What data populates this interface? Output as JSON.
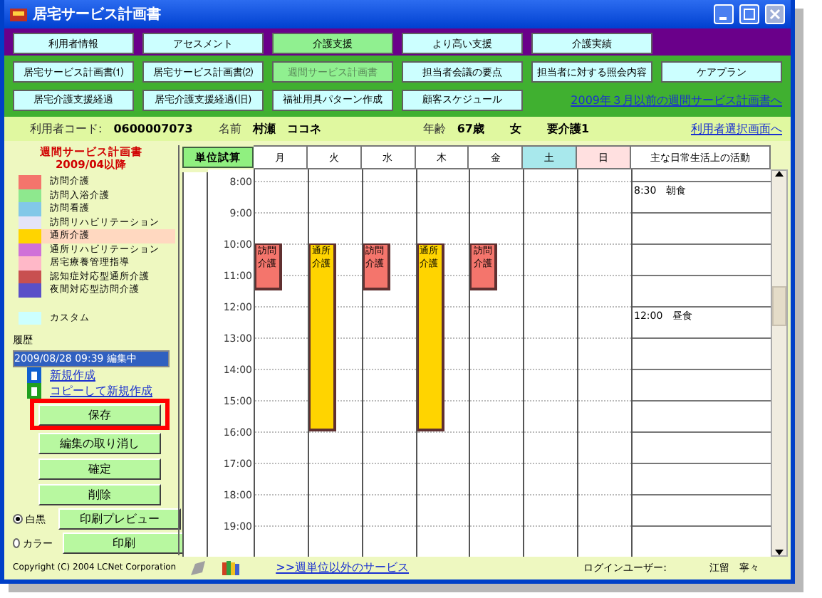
{
  "window": {
    "title": "居宅サービス計画書"
  },
  "nav_primary": [
    {
      "label": "利用者情報",
      "selected": false
    },
    {
      "label": "アセスメント",
      "selected": false
    },
    {
      "label": "介護支援",
      "selected": true
    },
    {
      "label": "より高い支援",
      "selected": false
    },
    {
      "label": "介護実績",
      "selected": false
    }
  ],
  "nav_secondary": [
    {
      "label": "居宅サービス計画書⑴",
      "selected": false
    },
    {
      "label": "居宅サービス計画書⑵",
      "selected": false
    },
    {
      "label": "週間サービス計画書",
      "selected": true
    },
    {
      "label": "担当者会議の要点",
      "selected": false
    },
    {
      "label": "担当者に対する照会内容",
      "selected": false
    },
    {
      "label": "ケアプラン",
      "selected": false
    },
    {
      "label": "居宅介護支援経過",
      "selected": false
    },
    {
      "label": "居宅介護支援経過(旧)",
      "selected": false
    },
    {
      "label": "福祉用具パターン作成",
      "selected": false
    },
    {
      "label": "顧客スケジュール",
      "selected": false
    }
  ],
  "old_plan_link": "2009年３月以前の週間サービス計画書へ",
  "user_info": {
    "code_label": "利用者コード:",
    "code": "0600007073",
    "name_label": "名前",
    "name": "村瀬　ココネ",
    "age_label": "年齢",
    "age": "67歳",
    "sex": "女",
    "care_level": "要介護1",
    "select_link": "利用者選択画面へ"
  },
  "sidebar": {
    "heading": "週間サービス計画書",
    "subheading": "2009/04以降",
    "legend": [
      {
        "label": "訪問介護",
        "color": "#f4756c",
        "selected": false
      },
      {
        "label": "訪問入浴介護",
        "color": "#8ee88e",
        "selected": false
      },
      {
        "label": "訪問看護",
        "color": "#82c8e8",
        "selected": false
      },
      {
        "label": "訪問リハビリテーション",
        "color": "#e4e4f8",
        "selected": false
      },
      {
        "label": "通所介護",
        "color": "#ffd400",
        "selected": true
      },
      {
        "label": "通所リハビリテーション",
        "color": "#d070d8",
        "selected": false
      },
      {
        "label": "居宅療養管理指導",
        "color": "#ffb8c8",
        "selected": false
      },
      {
        "label": "認知症対応型通所介護",
        "color": "#c85050",
        "selected": false
      },
      {
        "label": "夜間対応型訪問介護",
        "color": "#5a50c8",
        "selected": false
      },
      {
        "label": "カスタム",
        "color": "#ccffff",
        "selected": false
      }
    ],
    "history_label": "履歴",
    "history": [
      {
        "label": "2009/08/28 09:39 編集中",
        "selected": true
      }
    ],
    "links": [
      {
        "label": "新規作成",
        "kind": "new"
      },
      {
        "label": "コピーして新規作成",
        "kind": "copy"
      }
    ],
    "buttons": [
      {
        "label": "保存",
        "highlighted": true
      },
      {
        "label": "編集の取り消し",
        "highlighted": false
      },
      {
        "label": "確定",
        "highlighted": false
      },
      {
        "label": "削除",
        "highlighted": false
      },
      {
        "label": "印刷プレビュー",
        "highlighted": false
      },
      {
        "label": "印刷",
        "highlighted": false
      }
    ],
    "print_modes": [
      {
        "label": "白黒",
        "selected": true
      },
      {
        "label": "カラー",
        "selected": false
      }
    ]
  },
  "schedule": {
    "calc_button": "単位試算",
    "rows": [
      {
        "time": "8:00",
        "activity": "8:30　朝食"
      },
      {
        "time": "9:00"
      },
      {
        "time": "10:00"
      },
      {
        "time": "11:00"
      },
      {
        "time": "12:00",
        "activity": "12:00　昼食"
      },
      {
        "time": "13:00"
      },
      {
        "time": "14:00"
      },
      {
        "time": "15:00"
      },
      {
        "time": "16:00"
      },
      {
        "time": "17:00"
      },
      {
        "time": "18:00"
      },
      {
        "time": "19:00"
      }
    ],
    "days": [
      {
        "label": "月",
        "kind": "weekday",
        "service": {
          "label": "訪問介護",
          "color": "#f4756c"
        },
        "slots": [
          false,
          false,
          false,
          false,
          true,
          true,
          true,
          false,
          false,
          false,
          false,
          false,
          false,
          false,
          false,
          false,
          false,
          false,
          false,
          false,
          false,
          false,
          false,
          false
        ]
      },
      {
        "label": "火",
        "kind": "weekday",
        "service": {
          "label": "通所介護",
          "color": "#ffd400"
        },
        "slots": [
          false,
          false,
          false,
          false,
          true,
          true,
          true,
          true,
          true,
          true,
          true,
          true,
          true,
          true,
          true,
          true,
          false,
          false,
          false,
          false,
          false,
          false,
          false,
          false
        ]
      },
      {
        "label": "水",
        "kind": "weekday",
        "service": {
          "label": "訪問介護",
          "color": "#f4756c"
        },
        "slots": [
          false,
          false,
          false,
          false,
          true,
          true,
          true,
          false,
          false,
          false,
          false,
          false,
          false,
          false,
          false,
          false,
          false,
          false,
          false,
          false,
          false,
          false,
          false,
          false
        ]
      },
      {
        "label": "木",
        "kind": "weekday",
        "service": {
          "label": "通所介護",
          "color": "#ffd400"
        },
        "slots": [
          false,
          false,
          false,
          false,
          true,
          true,
          true,
          true,
          true,
          true,
          true,
          true,
          true,
          true,
          true,
          true,
          false,
          false,
          false,
          false,
          false,
          false,
          false,
          false
        ]
      },
      {
        "label": "金",
        "kind": "weekday",
        "service": {
          "label": "訪問介護",
          "color": "#f4756c"
        },
        "slots": [
          false,
          false,
          false,
          false,
          true,
          true,
          true,
          false,
          false,
          false,
          false,
          false,
          false,
          false,
          false,
          false,
          false,
          false,
          false,
          false,
          false,
          false,
          false,
          false
        ]
      },
      {
        "label": "土",
        "kind": "saturday"
      },
      {
        "label": "日",
        "kind": "sunday"
      }
    ],
    "activities_header": "主な日常生活上の活動"
  },
  "footer": {
    "copyright": "Copyright (C) 2004 LCNet Corporation",
    "other_services_link": ">>週単位以外のサービス",
    "login_label": "ログインユーザー:",
    "login_user": "江留　寧々"
  }
}
